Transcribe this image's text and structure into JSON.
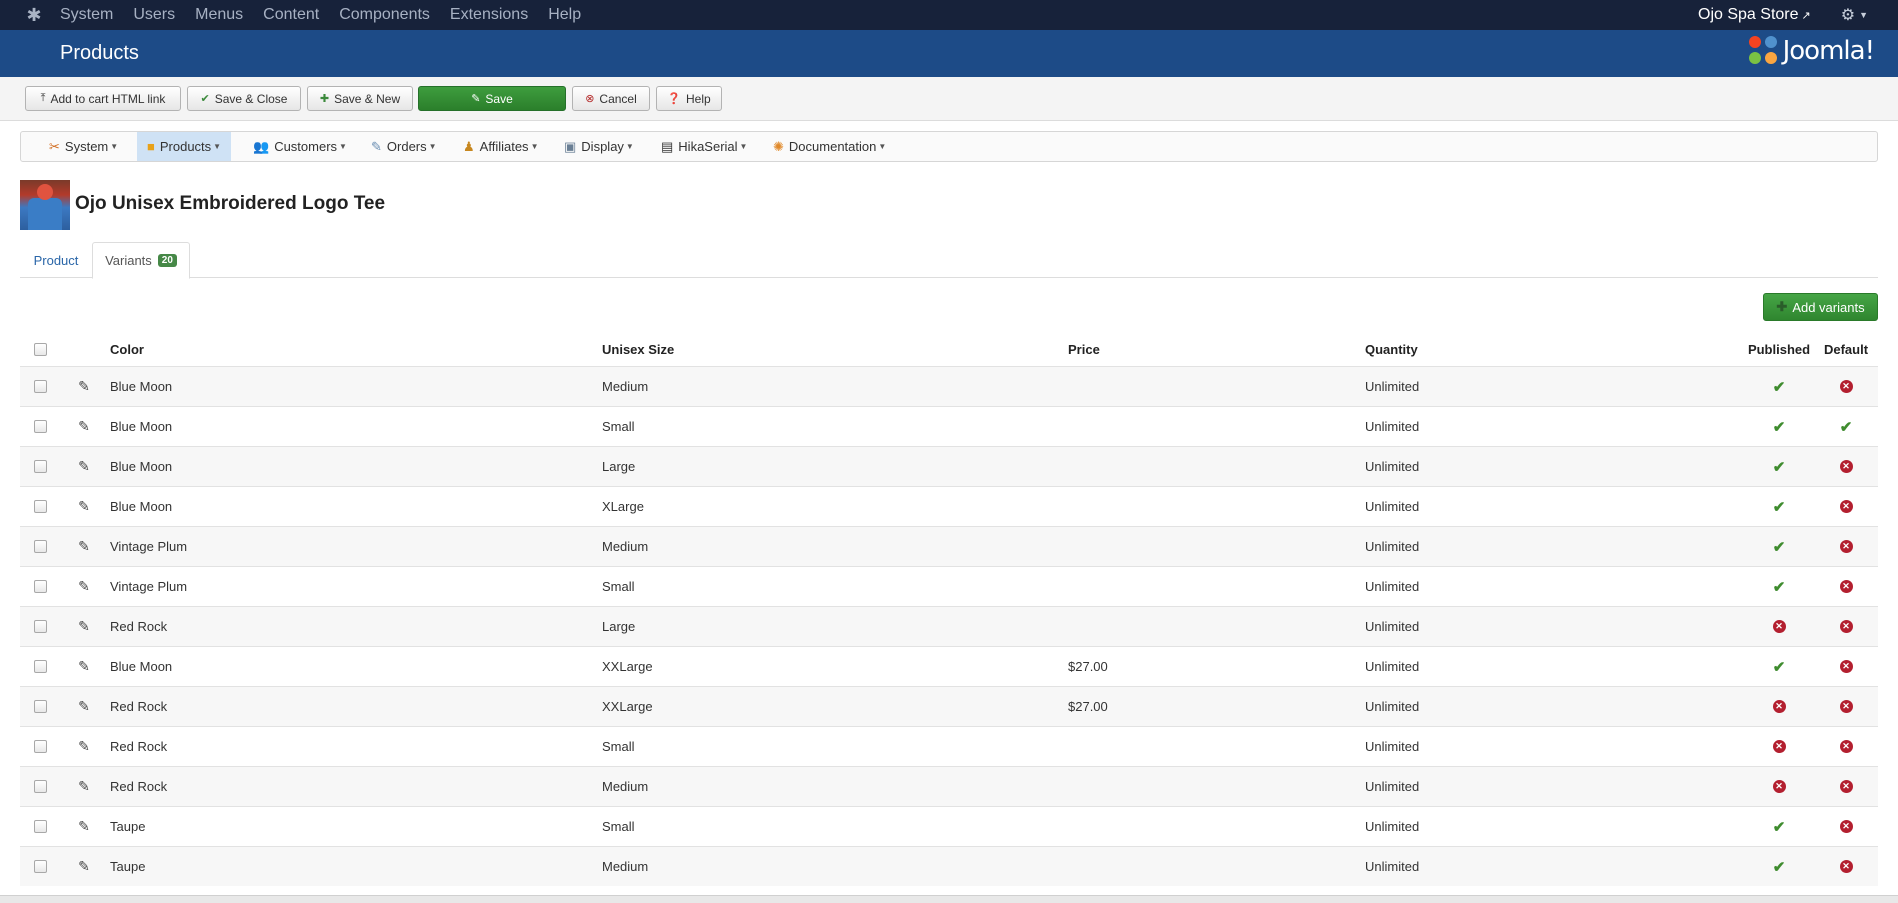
{
  "topbar": {
    "menu": [
      "System",
      "Users",
      "Menus",
      "Content",
      "Components",
      "Extensions",
      "Help"
    ],
    "site_name": "Ojo Spa Store"
  },
  "header": {
    "title": "Products",
    "brand": "Joomla!"
  },
  "toolbar": {
    "add_to_cart": "Add to cart HTML link",
    "save_close": "Save & Close",
    "save_new": "Save & New",
    "save": "Save",
    "cancel": "Cancel",
    "help": "Help"
  },
  "hikamenu": [
    "System",
    "Products",
    "Customers",
    "Orders",
    "Affiliates",
    "Display",
    "HikaSerial",
    "Documentation"
  ],
  "product": {
    "title": "Ojo Unisex Embroidered Logo Tee"
  },
  "tabs": {
    "product": "Product",
    "variants": "Variants",
    "variants_count": "20"
  },
  "add_variants": "Add variants",
  "table": {
    "headers": {
      "color": "Color",
      "size": "Unisex Size",
      "price": "Price",
      "quantity": "Quantity",
      "published": "Published",
      "default": "Default"
    },
    "rows": [
      {
        "color": "Blue Moon",
        "size": "Medium",
        "price": "",
        "quantity": "Unlimited",
        "published": true,
        "default": false
      },
      {
        "color": "Blue Moon",
        "size": "Small",
        "price": "",
        "quantity": "Unlimited",
        "published": true,
        "default": true
      },
      {
        "color": "Blue Moon",
        "size": "Large",
        "price": "",
        "quantity": "Unlimited",
        "published": true,
        "default": false
      },
      {
        "color": "Blue Moon",
        "size": "XLarge",
        "price": "",
        "quantity": "Unlimited",
        "published": true,
        "default": false
      },
      {
        "color": "Vintage Plum",
        "size": "Medium",
        "price": "",
        "quantity": "Unlimited",
        "published": true,
        "default": false
      },
      {
        "color": "Vintage Plum",
        "size": "Small",
        "price": "",
        "quantity": "Unlimited",
        "published": true,
        "default": false
      },
      {
        "color": "Red Rock",
        "size": "Large",
        "price": "",
        "quantity": "Unlimited",
        "published": false,
        "default": false
      },
      {
        "color": "Blue Moon",
        "size": "XXLarge",
        "price": "$27.00",
        "quantity": "Unlimited",
        "published": true,
        "default": false
      },
      {
        "color": "Red Rock",
        "size": "XXLarge",
        "price": "$27.00",
        "quantity": "Unlimited",
        "published": false,
        "default": false
      },
      {
        "color": "Red Rock",
        "size": "Small",
        "price": "",
        "quantity": "Unlimited",
        "published": false,
        "default": false
      },
      {
        "color": "Red Rock",
        "size": "Medium",
        "price": "",
        "quantity": "Unlimited",
        "published": false,
        "default": false
      },
      {
        "color": "Taupe",
        "size": "Small",
        "price": "",
        "quantity": "Unlimited",
        "published": true,
        "default": false
      },
      {
        "color": "Taupe",
        "size": "Medium",
        "price": "",
        "quantity": "Unlimited",
        "published": true,
        "default": false
      }
    ]
  },
  "colors": {
    "admin_bar": "#17223a",
    "header": "#1d4b87",
    "save_green": "#2f862f",
    "check_green": "#3f8c2f",
    "unpublish_red": "#b31f2f",
    "active_menu": "#cfe2f5"
  }
}
